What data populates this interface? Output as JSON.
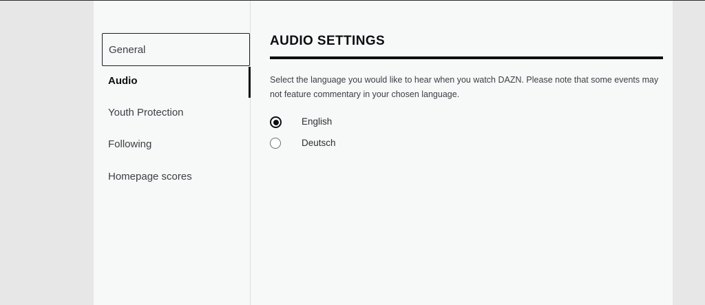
{
  "sidebar": {
    "items": [
      {
        "label": "General",
        "state": "focused"
      },
      {
        "label": "Audio",
        "state": "active"
      },
      {
        "label": "Youth Protection",
        "state": ""
      },
      {
        "label": "Following",
        "state": ""
      },
      {
        "label": "Homepage scores",
        "state": ""
      }
    ]
  },
  "main": {
    "title": "AUDIO SETTINGS",
    "description": "Select the language you would like to hear when you watch DAZN. Please note that some events may not feature commentary in your chosen language.",
    "options": [
      {
        "label": "English",
        "checked": true
      },
      {
        "label": "Deutsch",
        "checked": false
      }
    ]
  },
  "colors": {
    "page_background": "#e7e7e7",
    "panel_background": "#f7f8f8",
    "accent": "#0c0e10"
  }
}
